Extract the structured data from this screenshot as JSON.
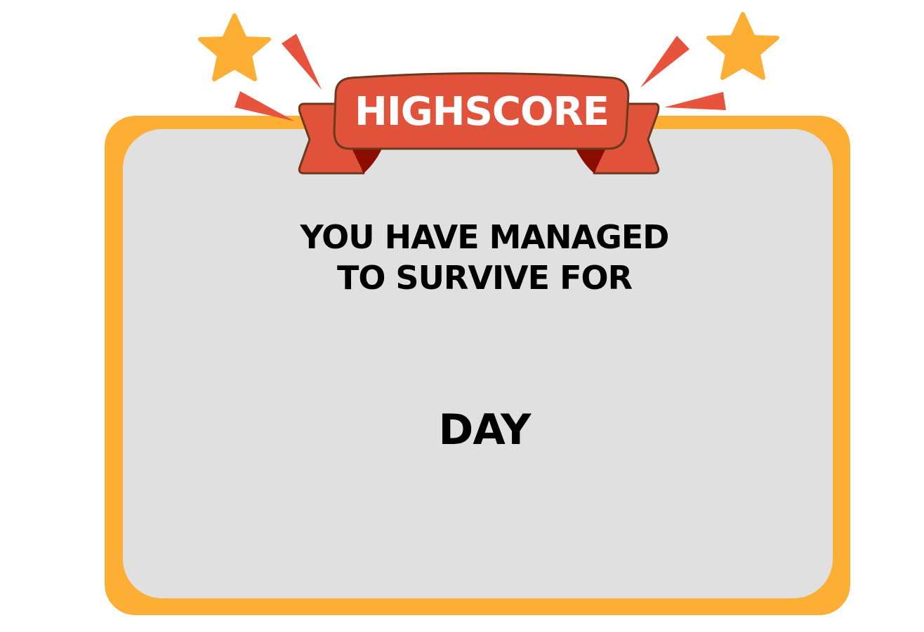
{
  "banner": {
    "title": "HIGHSCORE"
  },
  "message": {
    "line1": "YOU HAVE MANAGED",
    "line2": "TO SURVIVE FOR"
  },
  "score": {
    "value": "",
    "unit_label": "DAY"
  },
  "colors": {
    "frame": "#fdaf35",
    "panel": "#e0e0e0",
    "ribbon": "#e0533a",
    "ribbon_outline": "#6b3a1e",
    "ribbon_fold": "#8b0d00",
    "star": "#fdaf35",
    "burst": "#e8533e"
  },
  "icons": {
    "left_star": "star-icon",
    "right_star": "star-icon"
  }
}
